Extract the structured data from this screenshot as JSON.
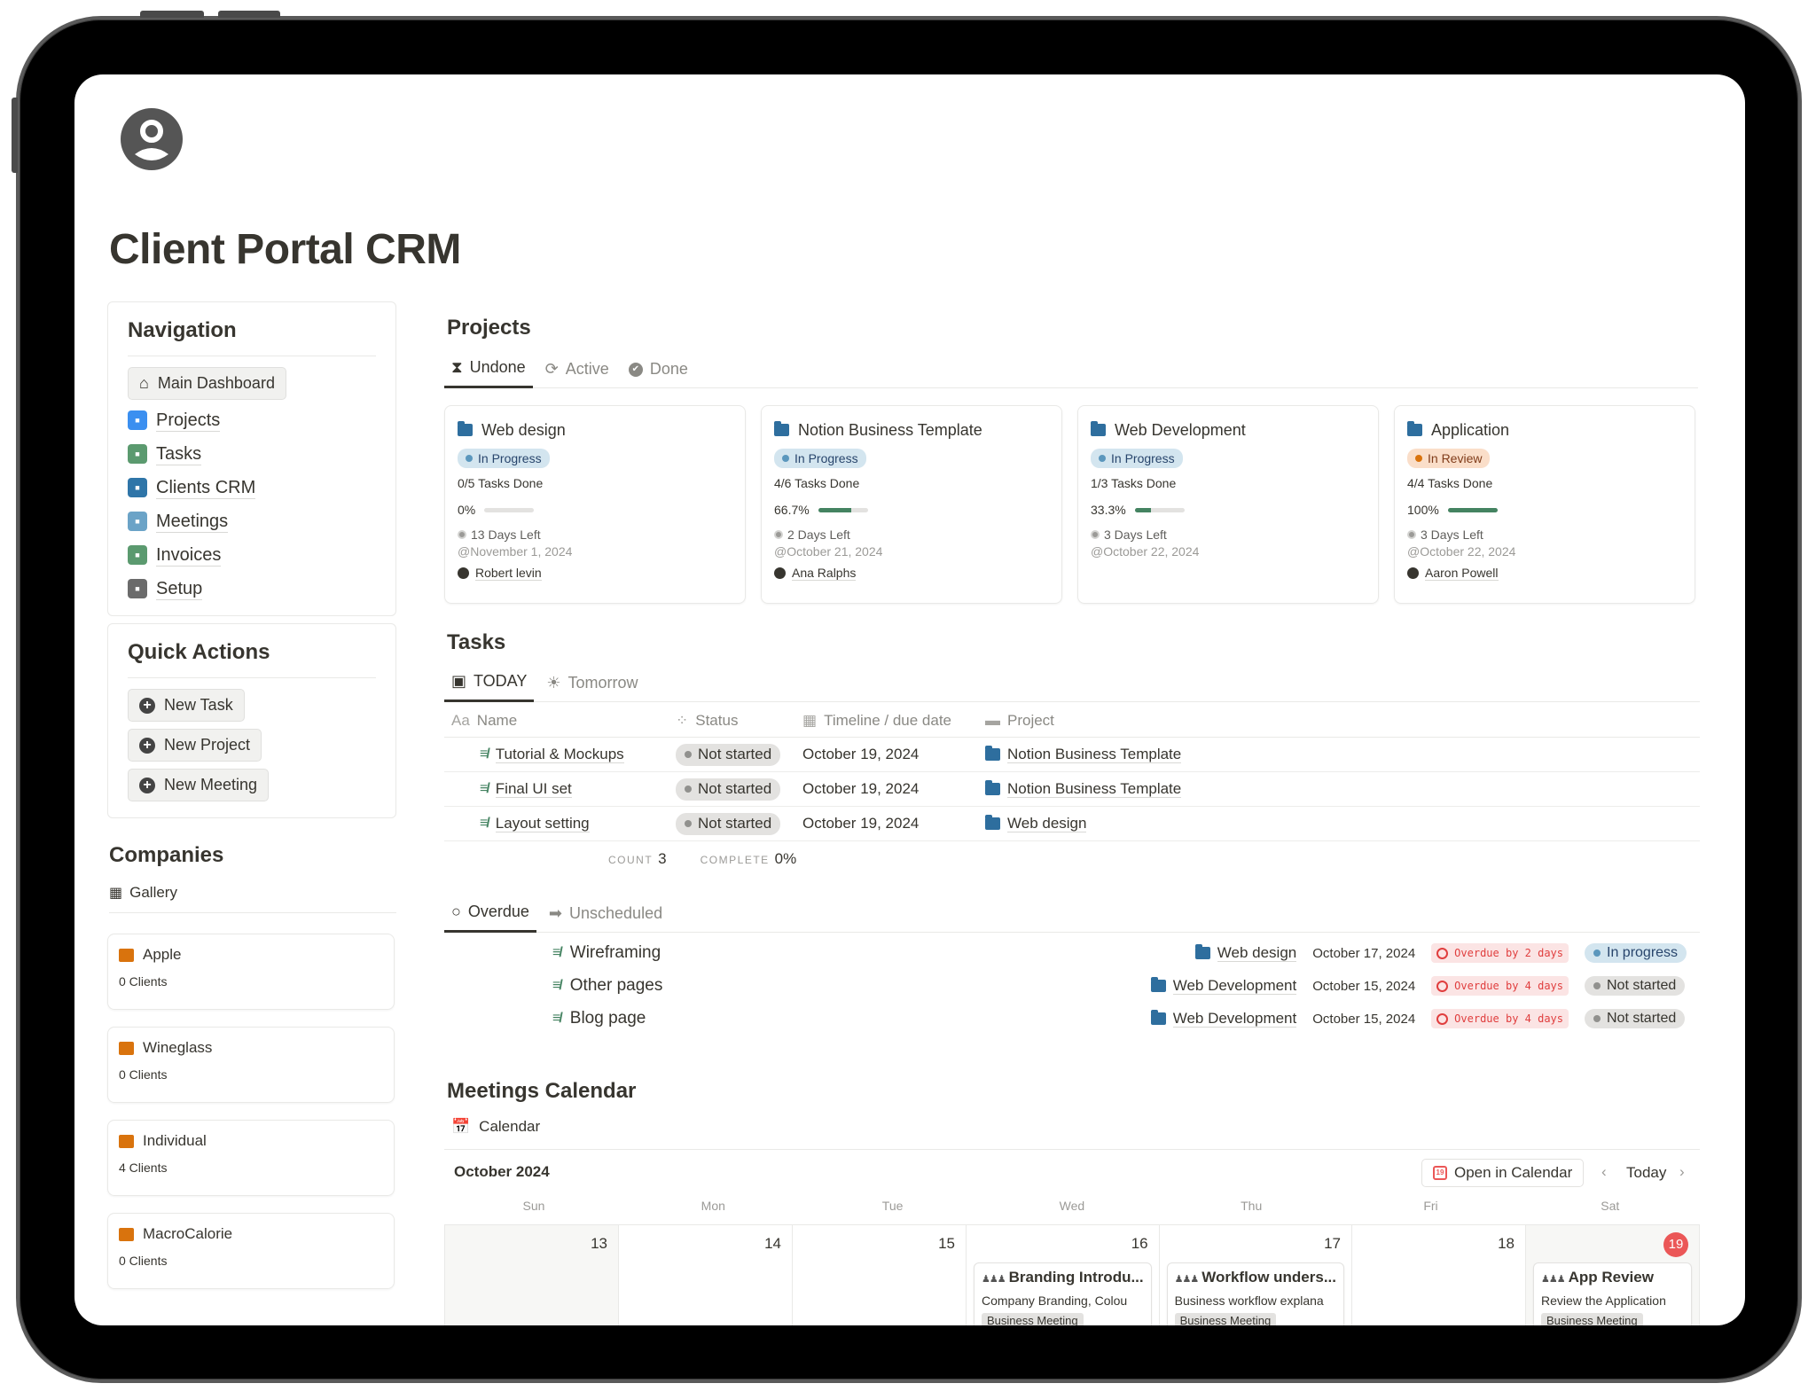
{
  "page": {
    "title": "Client Portal CRM",
    "avatar_icon": "user-circle-icon"
  },
  "navigation": {
    "title": "Navigation",
    "main_button": {
      "label": "Main Dashboard",
      "icon": "home-icon"
    },
    "items": [
      {
        "label": "Projects",
        "icon": "projects-icon",
        "color": "#3b8ff0"
      },
      {
        "label": "Tasks",
        "icon": "tasks-check-icon",
        "color": "#5b9a6f"
      },
      {
        "label": "Clients CRM",
        "icon": "clients-icon",
        "color": "#2f75a8"
      },
      {
        "label": "Meetings",
        "icon": "meetings-icon",
        "color": "#6ba3c7"
      },
      {
        "label": "Invoices",
        "icon": "invoice-icon",
        "color": "#5b9a6f"
      },
      {
        "label": "Setup",
        "icon": "gear-icon",
        "color": "#6b6b6b"
      }
    ]
  },
  "quick_actions": {
    "title": "Quick Actions",
    "buttons": [
      {
        "label": "New Task",
        "icon": "plus-circle-icon"
      },
      {
        "label": "New Project",
        "icon": "plus-circle-icon"
      },
      {
        "label": "New Meeting",
        "icon": "plus-circle-icon"
      }
    ]
  },
  "companies": {
    "title": "Companies",
    "view_label": "Gallery",
    "items": [
      {
        "name": "Apple",
        "clients": "0 Clients"
      },
      {
        "name": "Wineglass",
        "clients": "0 Clients"
      },
      {
        "name": "Individual",
        "clients": "4 Clients"
      },
      {
        "name": "MacroCalorie",
        "clients": "0 Clients"
      }
    ]
  },
  "projects": {
    "title": "Projects",
    "tabs": [
      {
        "label": "Undone",
        "icon": "hourglass-icon",
        "active": true
      },
      {
        "label": "Active",
        "icon": "active-icon",
        "active": false
      },
      {
        "label": "Done",
        "icon": "check-circle-icon",
        "active": false
      }
    ],
    "cards": [
      {
        "name": "Web design",
        "status": "In Progress",
        "status_color": "blue",
        "tasks_done": "0/5 Tasks Done",
        "progress_label": "0%",
        "progress": 0,
        "days_left": "13 Days Left",
        "due": "@November 1, 2024",
        "owner": "Robert levin"
      },
      {
        "name": "Notion Business Template",
        "status": "In Progress",
        "status_color": "blue",
        "tasks_done": "4/6 Tasks Done",
        "progress_label": "66.7%",
        "progress": 66.7,
        "days_left": "2 Days Left",
        "due": "@October 21, 2024",
        "owner": "Ana Ralphs"
      },
      {
        "name": "Web Development",
        "status": "In Progress",
        "status_color": "blue",
        "tasks_done": "1/3 Tasks Done",
        "progress_label": "33.3%",
        "progress": 33.3,
        "days_left": "3 Days Left",
        "due": "@October 22, 2024",
        "owner": ""
      },
      {
        "name": "Application",
        "status": "In Review",
        "status_color": "orange",
        "tasks_done": "4/4 Tasks Done",
        "progress_label": "100%",
        "progress": 100,
        "days_left": "3 Days Left",
        "due": "@October 22, 2024",
        "owner": "Aaron Powell"
      }
    ]
  },
  "tasks": {
    "title": "Tasks",
    "tabs": [
      {
        "label": "TODAY",
        "icon": "calendar-icon",
        "active": true
      },
      {
        "label": "Tomorrow",
        "icon": "sunrise-icon",
        "active": false
      }
    ],
    "columns": [
      {
        "label": "Name",
        "icon": "Aa"
      },
      {
        "label": "Status",
        "icon": "status-spinner-icon"
      },
      {
        "label": "Timeline / due date",
        "icon": "calendar-icon"
      },
      {
        "label": "Project",
        "icon": "folder-icon"
      }
    ],
    "rows": [
      {
        "name": "Tutorial & Mockups",
        "status": "Not started",
        "date": "October 19, 2024",
        "project": "Notion Business Template"
      },
      {
        "name": "Final UI set",
        "status": "Not started",
        "date": "October 19, 2024",
        "project": "Notion Business Template"
      },
      {
        "name": "Layout setting",
        "status": "Not started",
        "date": "October 19, 2024",
        "project": "Web design"
      }
    ],
    "footer": {
      "count_label": "COUNT",
      "count": "3",
      "complete_label": "COMPLETE",
      "complete": "0%"
    }
  },
  "overdue": {
    "tabs": [
      {
        "label": "Overdue",
        "icon": "circle-icon",
        "active": true
      },
      {
        "label": "Unscheduled",
        "icon": "arrow-right-icon",
        "active": false
      }
    ],
    "rows": [
      {
        "name": "Wireframing",
        "project": "Web design",
        "date": "October 17, 2024",
        "overdue": "Overdue by 2 days",
        "status": "In progress",
        "status_color": "blue"
      },
      {
        "name": "Other pages",
        "project": "Web Development",
        "date": "October 15, 2024",
        "overdue": "Overdue by 4 days",
        "status": "Not started",
        "status_color": "gray"
      },
      {
        "name": "Blog page",
        "project": "Web Development",
        "date": "October 15, 2024",
        "overdue": "Overdue by 4 days",
        "status": "Not started",
        "status_color": "gray"
      }
    ]
  },
  "meetings": {
    "title": "Meetings Calendar",
    "view_label": "Calendar",
    "month": "October 2024",
    "open_in_calendar": "Open in Calendar",
    "open_icon_day": "19",
    "today_label": "Today",
    "weekdays": [
      "Sun",
      "Mon",
      "Tue",
      "Wed",
      "Thu",
      "Fri",
      "Sat"
    ],
    "days": [
      {
        "num": "13",
        "weekend": true,
        "today": false,
        "event": null
      },
      {
        "num": "14",
        "weekend": false,
        "today": false,
        "event": null
      },
      {
        "num": "15",
        "weekend": false,
        "today": false,
        "event": null
      },
      {
        "num": "16",
        "weekend": false,
        "today": false,
        "event": {
          "title": "Branding Introdu...",
          "desc": "Company Branding, Colou",
          "tag": "Business Meeting"
        }
      },
      {
        "num": "17",
        "weekend": false,
        "today": false,
        "event": {
          "title": "Workflow unders...",
          "desc": "Business workflow explana",
          "tag": "Business Meeting"
        }
      },
      {
        "num": "18",
        "weekend": false,
        "today": false,
        "event": null
      },
      {
        "num": "19",
        "weekend": true,
        "today": true,
        "event": {
          "title": "App Review",
          "desc": "Review the Application",
          "tag": "Business Meeting"
        }
      }
    ]
  }
}
